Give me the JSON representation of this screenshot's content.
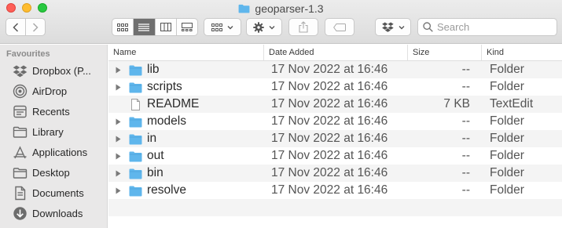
{
  "window": {
    "title": "geoparser-1.3"
  },
  "toolbar": {
    "search_placeholder": "Search"
  },
  "sidebar": {
    "heading": "Favourites",
    "items": [
      {
        "label": "Dropbox (P...",
        "icon": "dropbox-icon"
      },
      {
        "label": "AirDrop",
        "icon": "airdrop-icon"
      },
      {
        "label": "Recents",
        "icon": "recents-icon"
      },
      {
        "label": "Library",
        "icon": "folder-icon"
      },
      {
        "label": "Applications",
        "icon": "applications-icon"
      },
      {
        "label": "Desktop",
        "icon": "desktop-icon"
      },
      {
        "label": "Documents",
        "icon": "documents-icon"
      },
      {
        "label": "Downloads",
        "icon": "downloads-icon"
      }
    ]
  },
  "columns": {
    "name": "Name",
    "date": "Date Added",
    "size": "Size",
    "kind": "Kind"
  },
  "files": [
    {
      "name": "lib",
      "date": "17 Nov 2022 at 16:46",
      "size": "--",
      "kind": "Folder",
      "type": "folder"
    },
    {
      "name": "scripts",
      "date": "17 Nov 2022 at 16:46",
      "size": "--",
      "kind": "Folder",
      "type": "folder"
    },
    {
      "name": "README",
      "date": "17 Nov 2022 at 16:46",
      "size": "7 KB",
      "kind": "TextEdit",
      "type": "file"
    },
    {
      "name": "models",
      "date": "17 Nov 2022 at 16:46",
      "size": "--",
      "kind": "Folder",
      "type": "folder"
    },
    {
      "name": "in",
      "date": "17 Nov 2022 at 16:46",
      "size": "--",
      "kind": "Folder",
      "type": "folder"
    },
    {
      "name": "out",
      "date": "17 Nov 2022 at 16:46",
      "size": "--",
      "kind": "Folder",
      "type": "folder"
    },
    {
      "name": "bin",
      "date": "17 Nov 2022 at 16:46",
      "size": "--",
      "kind": "Folder",
      "type": "folder"
    },
    {
      "name": "resolve",
      "date": "17 Nov 2022 at 16:46",
      "size": "--",
      "kind": "Folder",
      "type": "folder"
    }
  ],
  "colors": {
    "folder_blue": "#5fb6ec",
    "accent_gray": "#6f6f6f"
  }
}
